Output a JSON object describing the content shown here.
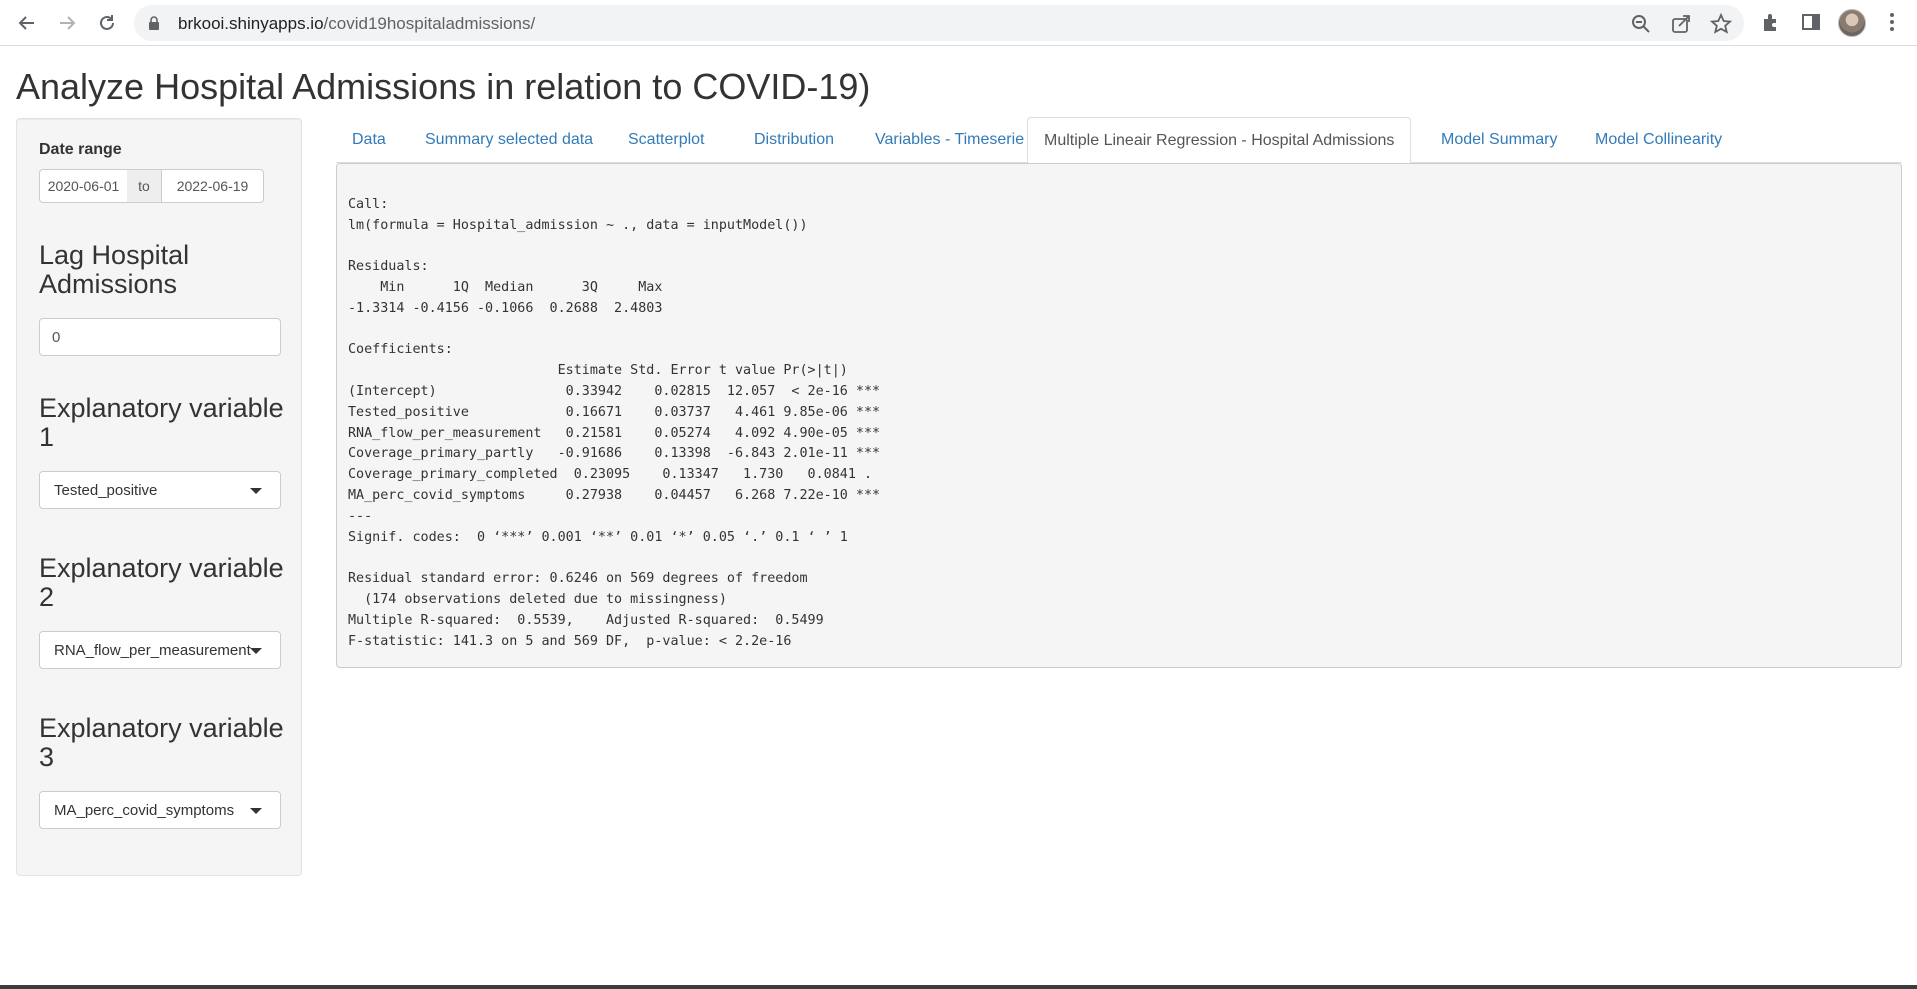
{
  "browser": {
    "url_host": "brkooi.shinyapps.io",
    "url_path": "/covid19hospitaladmissions/",
    "icons": [
      "back-icon",
      "forward-icon",
      "reload-icon",
      "lock-icon",
      "zoom-icon",
      "share-icon",
      "star-icon",
      "extensions-icon",
      "side-panel-icon",
      "menu-icon"
    ]
  },
  "app": {
    "title": "Analyze Hospital Admissions in relation to COVID-19)"
  },
  "sidebar": {
    "date_range_label": "Date range",
    "date_start": "2020-06-01",
    "date_sep": "to",
    "date_end": "2022-06-19",
    "lag_label": "Lag Hospital Admissions",
    "lag_value": "0",
    "var1_label": "Explanatory variable 1",
    "var1_value": "Tested_positive",
    "var2_label": "Explanatory variable 2",
    "var2_value": "RNA_flow_per_measurement",
    "var3_label": "Explanatory variable 3",
    "var3_value": "MA_perc_covid_symptoms"
  },
  "tabs": [
    {
      "label": "Data"
    },
    {
      "label": "Summary selected data"
    },
    {
      "label": "Scatterplot"
    },
    {
      "label": "Distribution"
    },
    {
      "label": "Variables - Timeserie"
    },
    {
      "label": "Multiple Lineair Regression - Hospital Admissions"
    },
    {
      "label": "Model Summary"
    },
    {
      "label": "Model Collinearity"
    }
  ],
  "active_tab": "Multiple Lineair Regression - Hospital Admissions",
  "output": {
    "text": "\nCall:\nlm(formula = Hospital_admission ~ ., data = inputModel())\n\nResiduals:\n    Min      1Q  Median      3Q     Max \n-1.3314 -0.4156 -0.1066  0.2688  2.4803 \n\nCoefficients:\n                          Estimate Std. Error t value Pr(>|t|)    \n(Intercept)                0.33942    0.02815  12.057  < 2e-16 ***\nTested_positive            0.16671    0.03737   4.461 9.85e-06 ***\nRNA_flow_per_measurement   0.21581    0.05274   4.092 4.90e-05 ***\nCoverage_primary_partly   -0.91686    0.13398  -6.843 2.01e-11 ***\nCoverage_primary_completed  0.23095    0.13347   1.730   0.0841 .  \nMA_perc_covid_symptoms     0.27938    0.04457   6.268 7.22e-10 ***\n---\nSignif. codes:  0 ‘***’ 0.001 ‘**’ 0.01 ‘*’ 0.05 ‘.’ 0.1 ‘ ’ 1\n\nResidual standard error: 0.6246 on 569 degrees of freedom\n  (174 observations deleted due to missingness)\nMultiple R-squared:  0.5539,\tAdjusted R-squared:  0.5499 \nF-statistic: 141.3 on 5 and 569 DF,  p-value: < 2.2e-16"
  },
  "colors": {
    "link": "#337ab7",
    "well_bg": "#f5f5f5"
  }
}
